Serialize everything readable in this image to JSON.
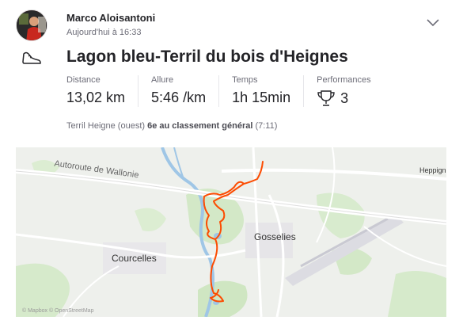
{
  "athlete": {
    "name": "Marco Aloisantoni",
    "timestamp": "Aujourd'hui à 16:33"
  },
  "activity": {
    "sport_icon": "shoe-icon",
    "title": "Lagon bleu-Terril du bois d'Heignes"
  },
  "stats": [
    {
      "label": "Distance",
      "value": "13,02 km"
    },
    {
      "label": "Allure",
      "value": "5:46 /km"
    },
    {
      "label": "Temps",
      "value": "1h 15min"
    },
    {
      "label": "Performances",
      "value": "3",
      "icon": "trophy-icon"
    }
  ],
  "segment": {
    "name": "Terril Heigne (ouest)",
    "rank": "6e au classement général",
    "time": "(7:11)"
  },
  "map": {
    "labels": {
      "highway": "Autoroute de Wallonie",
      "town1": "Courcelles",
      "town2": "Gosselies",
      "town3": "Heppign"
    },
    "attribution": "© Mapbox © OpenStreetMap",
    "route_color": "#fc4c02"
  },
  "header": {
    "menu_icon": "chevron-down-icon"
  }
}
